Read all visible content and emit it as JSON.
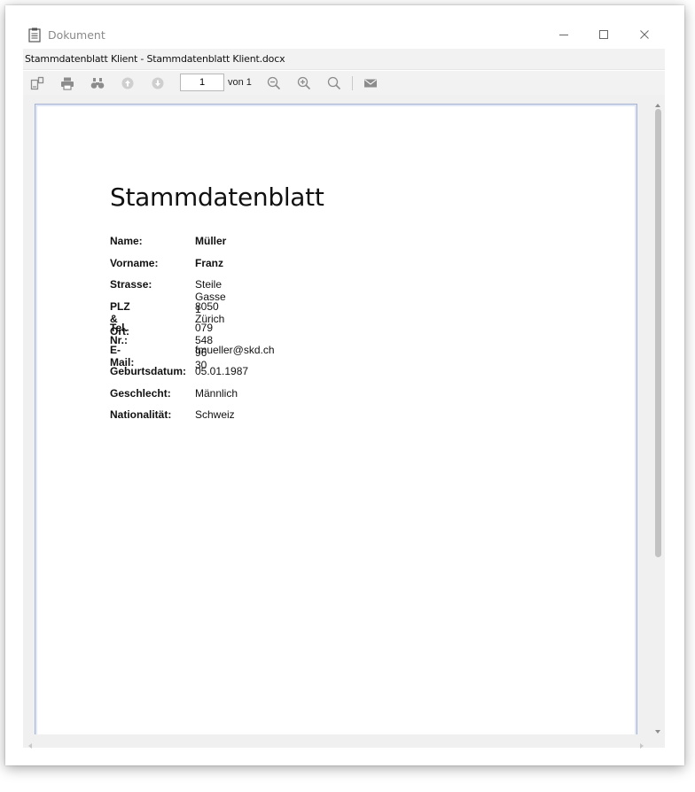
{
  "window": {
    "title": "Dokument",
    "icons": {
      "app": "document-icon",
      "minimize": "minimize-icon",
      "maximize": "maximize-icon",
      "close": "close-icon"
    }
  },
  "file_bar": {
    "filename": "Stammdatenblatt Klient - Stammdatenblatt Klient.docx"
  },
  "toolbar": {
    "page_value": "1",
    "of_label": "von 1",
    "icons": [
      "page-layout-icon",
      "print-icon",
      "find-icon",
      "previous-page-icon",
      "next-page-icon",
      "zoom-out-icon",
      "zoom-in-icon",
      "zoom-icon",
      "mail-icon"
    ]
  },
  "document": {
    "title": "Stammdatenblatt",
    "fields": [
      {
        "label": "Name:",
        "value": "Müller"
      },
      {
        "label": "Vorname:",
        "value": "Franz"
      },
      {
        "label": "Strasse:",
        "value": "Steile Gasse 1"
      },
      {
        "label": "PLZ & Ort:",
        "value": "8050 Zürich"
      },
      {
        "label": "Tel. Nr.:",
        "value": "079 548 96 30"
      },
      {
        "label": "E-Mail:",
        "value": "fmueller@skd.ch"
      },
      {
        "label": "Geburtsdatum:",
        "value": "05.01.1987"
      },
      {
        "label": "Geschlecht:",
        "value": "Männlich"
      },
      {
        "label": "Nationalität:",
        "value": "Schweiz"
      }
    ]
  },
  "colors": {
    "toolbar_bg": "#f2f2f2",
    "viewer_bg": "#f0f0f0",
    "page_border": "#a8b4cf",
    "icon_gray": "#8c8c8c",
    "icon_disabled": "#c8c8c8"
  }
}
